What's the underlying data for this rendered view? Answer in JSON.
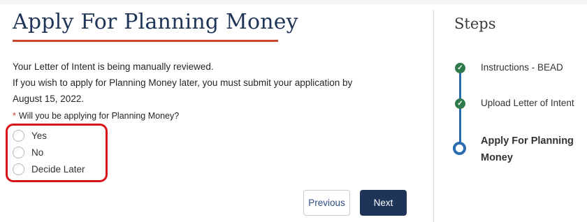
{
  "main": {
    "title": "Apply For Planning Money",
    "info_lines": [
      "Your Letter of Intent is being manually reviewed.",
      "If you wish to apply for Planning Money later, you must submit your application by",
      "August 15, 2022."
    ],
    "question": {
      "required_marker": "*",
      "text": "Will you be applying for Planning Money?"
    },
    "options": [
      {
        "label": "Yes",
        "selected": false
      },
      {
        "label": "No",
        "selected": false
      },
      {
        "label": "Decide Later",
        "selected": false
      }
    ],
    "buttons": {
      "previous": "Previous",
      "next": "Next"
    }
  },
  "sidebar": {
    "title": "Steps",
    "steps": [
      {
        "label": "Instructions - BEAD",
        "status": "complete",
        "icon": "check-icon"
      },
      {
        "label": "Upload Letter of Intent",
        "status": "complete",
        "icon": "check-icon"
      },
      {
        "label_lines": [
          "Apply For Planning",
          "Money"
        ],
        "status": "current",
        "icon": "current-step-icon"
      }
    ]
  },
  "colors": {
    "title": "#1f3557",
    "title_underline": "#c8472b",
    "highlight": "#d7141a",
    "next_button": "#1f3557",
    "step_complete": "#2f7a4a",
    "step_line": "#2b6cb0"
  }
}
